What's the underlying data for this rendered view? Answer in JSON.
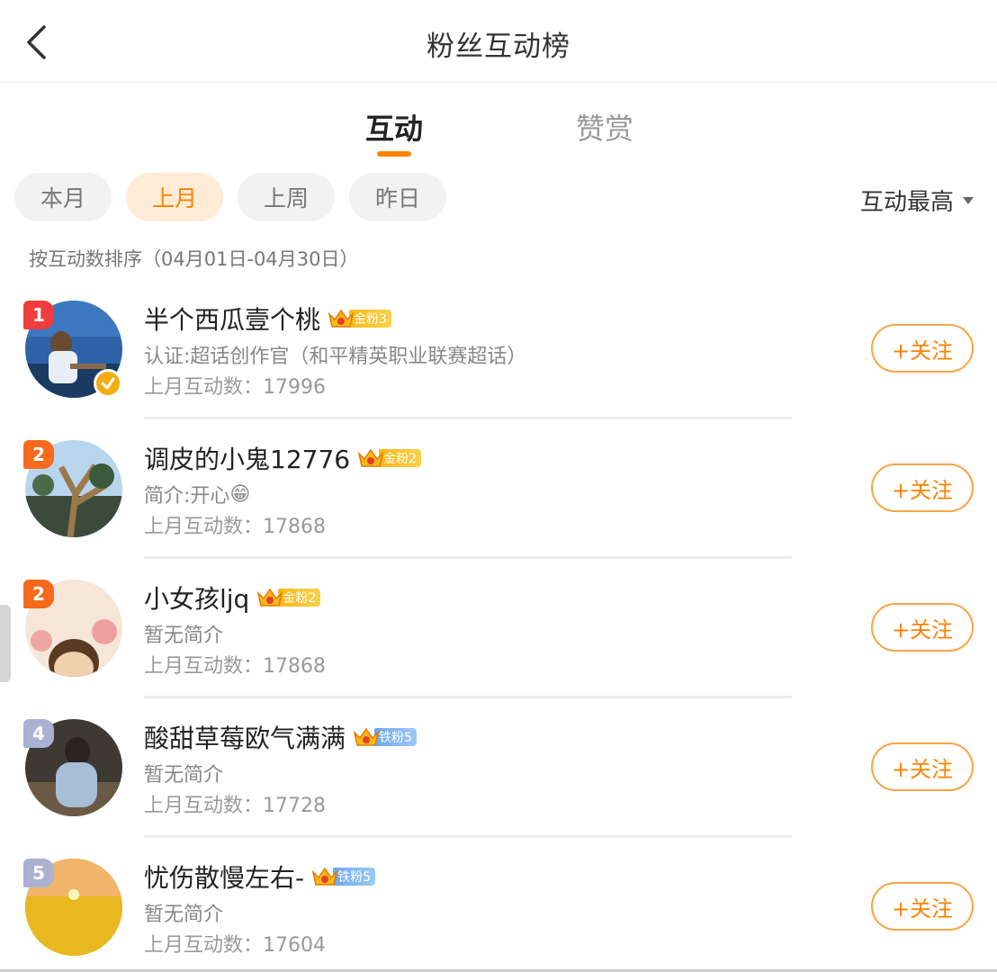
{
  "header": {
    "title": "粉丝互动榜"
  },
  "tabs": [
    {
      "label": "互动",
      "active": true
    },
    {
      "label": "赞赏",
      "active": false
    }
  ],
  "filters": [
    {
      "label": "本月",
      "active": false
    },
    {
      "label": "上月",
      "active": true
    },
    {
      "label": "上周",
      "active": false
    },
    {
      "label": "昨日",
      "active": false
    }
  ],
  "sort": {
    "label": "互动最高"
  },
  "sort_description": "按互动数排序（04月01日-04月30日）",
  "users": [
    {
      "rank": "1",
      "name": "半个西瓜壹个桃",
      "badge": "金粉3",
      "badge_type": "gold",
      "bio": "认证:超话创作官（和平精英职业联赛超话）",
      "count": "上月互动数：17996",
      "follow": "+关注",
      "verified": true
    },
    {
      "rank": "2",
      "name": "调皮的小鬼12776",
      "badge": "金粉2",
      "badge_type": "gold",
      "bio": "简介:开心",
      "bio_emoji": "😁",
      "count": "上月互动数：17868",
      "follow": "+关注"
    },
    {
      "rank": "2",
      "name": "小女孩ljq",
      "badge": "金粉2",
      "badge_type": "gold",
      "bio": "暂无简介",
      "count": "上月互动数：17868",
      "follow": "+关注"
    },
    {
      "rank": "4",
      "name": "酸甜草莓欧气满满",
      "badge": "铁粉5",
      "badge_type": "iron",
      "bio": "暂无简介",
      "count": "上月互动数：17728",
      "follow": "+关注"
    },
    {
      "rank": "5",
      "name": "忧伤散慢左右-",
      "badge": "铁粉5",
      "badge_type": "iron",
      "bio": "暂无简介",
      "count": "上月互动数：17604",
      "follow": "+关注"
    }
  ],
  "colors": {
    "accent": "#ff8200",
    "rank1": "#f03c3c",
    "rank2": "#f76a1b",
    "rank_other": "#aab1d2",
    "gold_badge": "#f9b718",
    "iron_badge": "#6aa6ea"
  }
}
